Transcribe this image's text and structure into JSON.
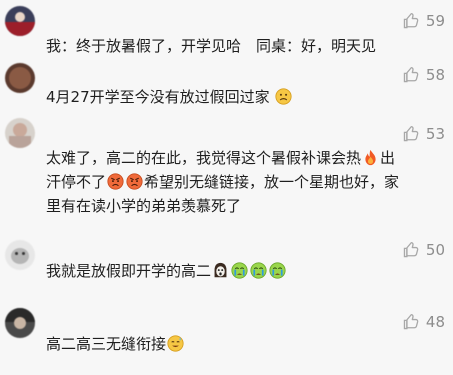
{
  "comments": [
    {
      "username": "",
      "likes": "59",
      "text": "我：终于放暑假了，开学见哈　同桌：好，明天见",
      "avatar_color": "#3b3f5a"
    },
    {
      "username": "",
      "likes": "58",
      "text": "4月27开学至今没有放过假回过家",
      "avatar_color": "#5b3a2e"
    },
    {
      "username": "",
      "likes": "53",
      "text_line1": "太难了，高二的在此，我觉得这个暑假补课会热",
      "text_line1_tail": "出",
      "text_line2_a": "汗停不了",
      "text_line2_b": "希望别无缝链接，放一个星期也好，家",
      "text_line3": "里有在读小学的弟弟羡慕死了",
      "avatar_color": "#d7d2cc"
    },
    {
      "username": "",
      "likes": "50",
      "text": "我就是放假即开学的高二",
      "avatar_color": "#e7e7e7"
    },
    {
      "username": "",
      "likes": "48",
      "text": "高二高三无缝衔接",
      "avatar_color": "#4a4a4a"
    }
  ],
  "icons": [
    "thumbs-up-icon",
    "confused-face-emoji",
    "fire-emoji",
    "angry-face-emoji",
    "ghost-face-emoji",
    "crying-face-emoji",
    "sweat-smile-emoji"
  ],
  "colors": {
    "like_icon": "#a8a8a8",
    "like_count": "#8d8d8d",
    "text": "#1f1f1f",
    "background": "#f7f7f7"
  }
}
